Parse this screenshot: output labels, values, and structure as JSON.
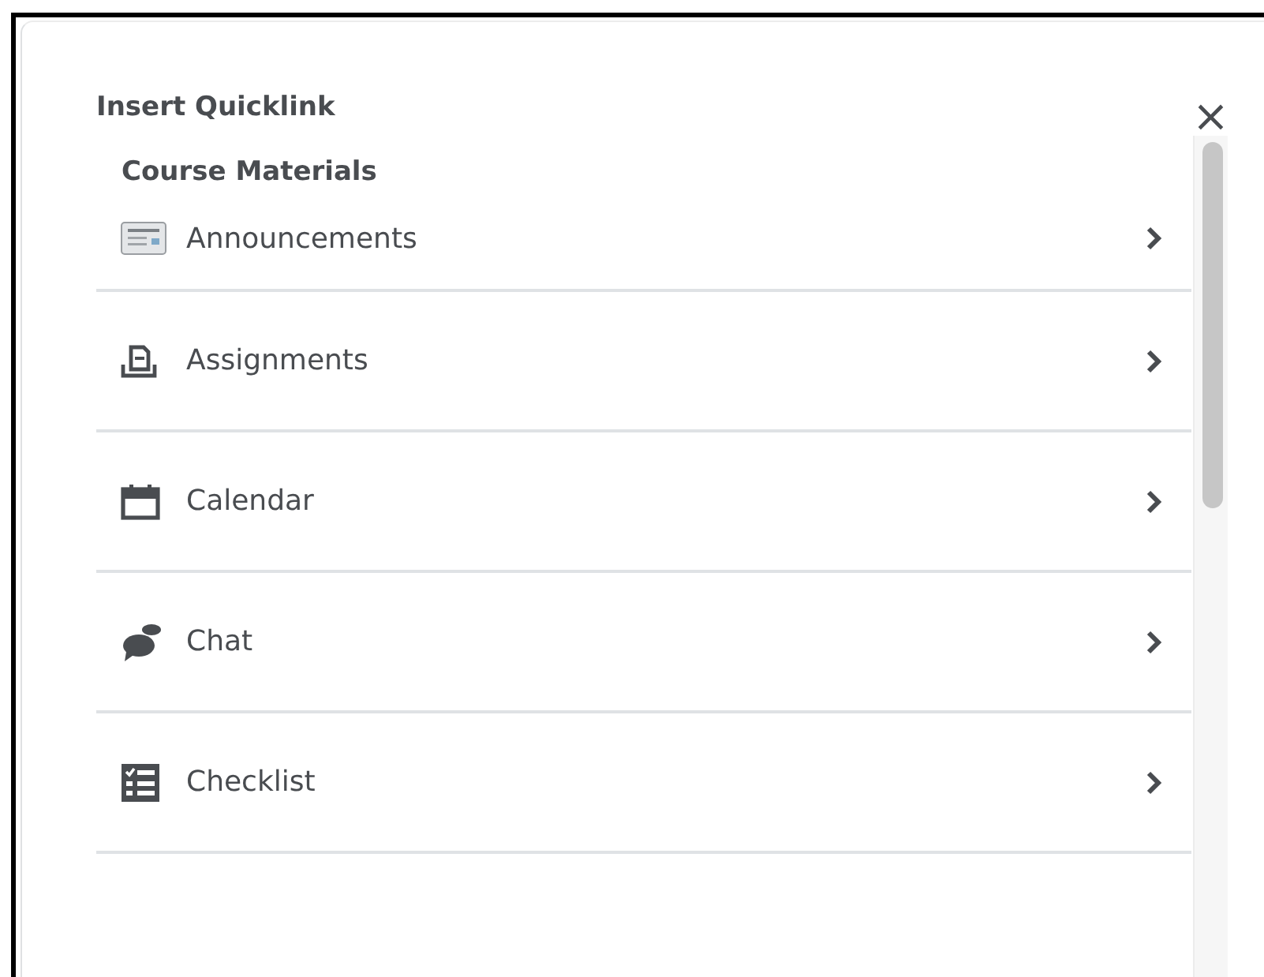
{
  "dialog": {
    "title": "Insert Quicklink",
    "close": "×"
  },
  "section": {
    "heading": "Course Materials",
    "items": [
      {
        "label": "Announcements"
      },
      {
        "label": "Assignments"
      },
      {
        "label": "Calendar"
      },
      {
        "label": "Chat"
      },
      {
        "label": "Checklist"
      }
    ]
  }
}
